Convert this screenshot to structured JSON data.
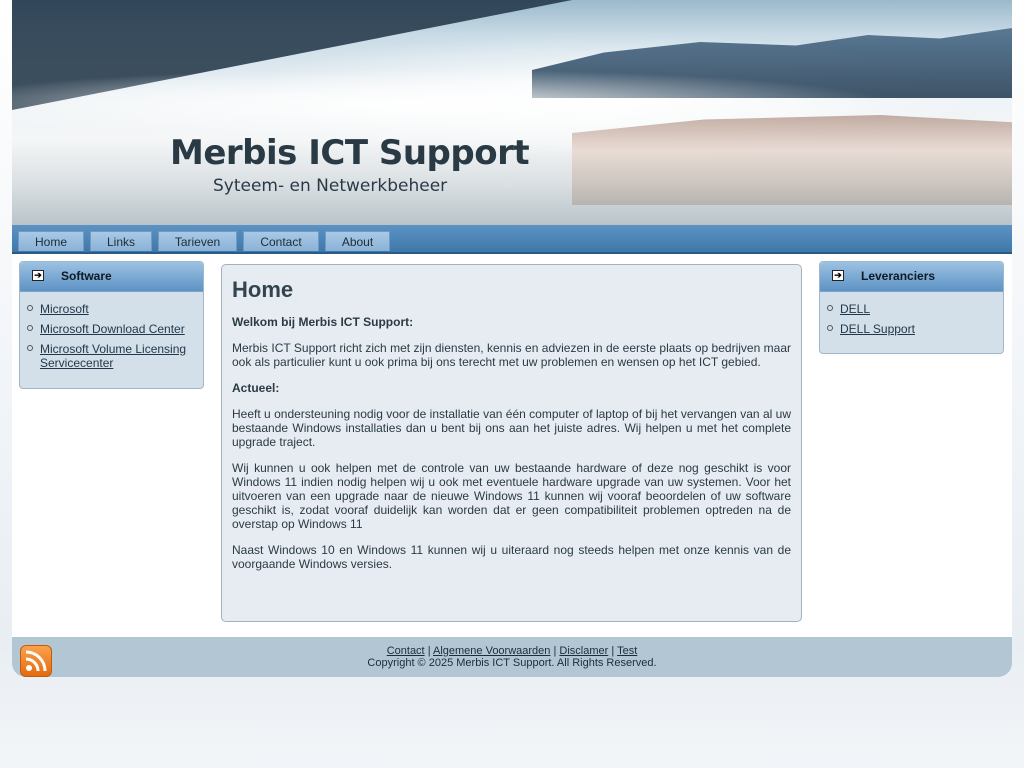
{
  "header": {
    "title": "Merbis ICT Support",
    "subtitle": "Syteem- en Netwerkbeheer"
  },
  "nav": {
    "items": [
      "Home",
      "Links",
      "Tarieven",
      "Contact",
      "About"
    ]
  },
  "left_box": {
    "title": "Software",
    "links": [
      "Microsoft",
      "Microsoft Download Center",
      "Microsoft Volume Licensing Servicecenter"
    ]
  },
  "right_box": {
    "title": "Leveranciers",
    "links": [
      "DELL",
      "DELL Support"
    ]
  },
  "main": {
    "heading": "Home",
    "welcome": "Welkom bij Merbis ICT Support:",
    "intro": "Merbis ICT Support richt zich met zijn diensten, kennis en adviezen in de eerste plaats op bedrijven maar ook als particulier kunt u ook prima bij ons terecht met uw problemen en wensen op het ICT gebied.",
    "actueel": "Actueel:",
    "p1": "Heeft u ondersteuning nodig voor de installatie van één computer of laptop of bij het vervangen van al uw bestaande Windows installaties dan u bent bij ons aan het juiste adres. Wij helpen u met het complete upgrade traject.",
    "p2": "Wij kunnen u ook helpen met de controle van uw bestaande hardware of deze nog geschikt is voor Windows 11 indien nodig helpen wij u ook met eventuele hardware upgrade van uw systemen. Voor het uitvoeren van een upgrade naar de nieuwe Windows 11 kunnen wij vooraf beoordelen of uw software geschikt is, zodat vooraf duidelijk kan worden dat er geen compatibiliteit problemen optreden na de overstap op Windows 11",
    "p3": "Naast Windows 10 en Windows 11 kunnen wij u uiteraard nog steeds helpen met onze kennis van de voorgaande Windows versies."
  },
  "footer": {
    "links": [
      "Contact",
      "Algemene Voorwaarden",
      "Disclamer",
      "Test"
    ],
    "separator": "|",
    "copyright": "Copyright © 2025 Merbis ICT Support. All Rights Reserved."
  },
  "icons": {
    "rss": "rss-feed-icon",
    "box_arrow": "arrow-right-box-icon",
    "bullet": "circle-bullet-icon"
  }
}
